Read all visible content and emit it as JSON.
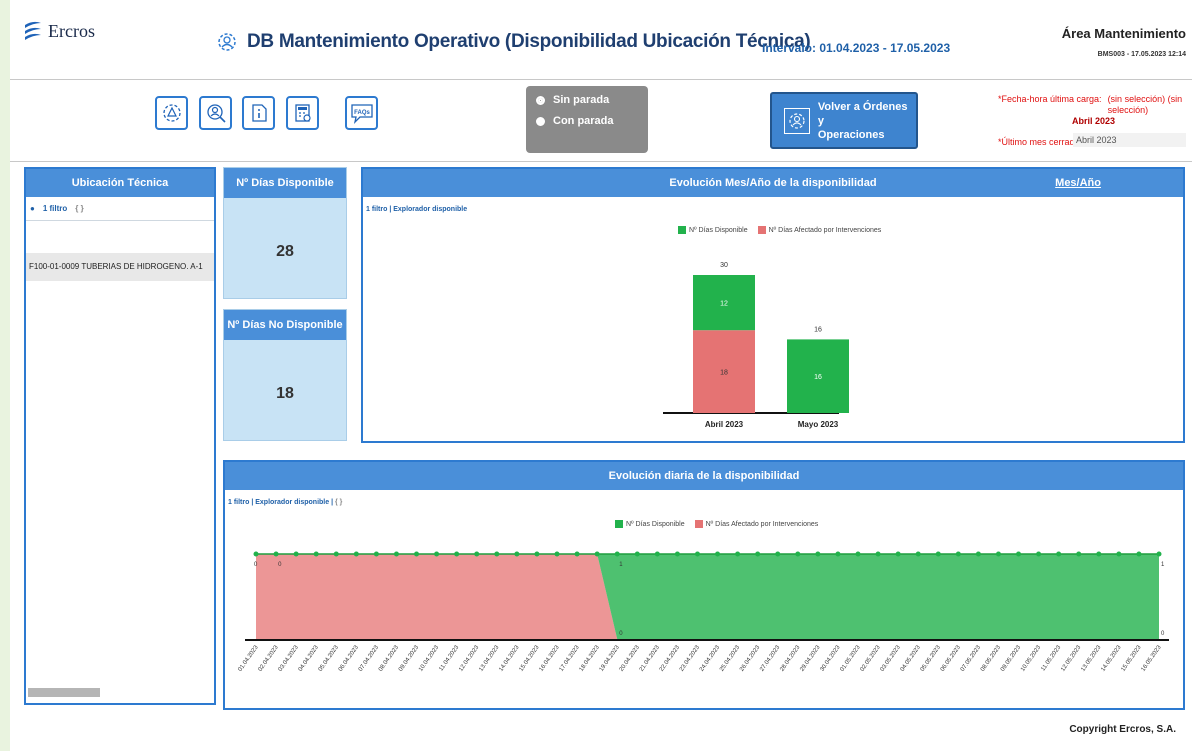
{
  "header": {
    "logo_text": "Ercros",
    "title": "DB Mantenimiento Operativo (Disponibilidad Ubicación Técnica)",
    "interval": "Intervalo: 01.04.2023 - 17.05.2023",
    "area": "Área Mantenimiento",
    "area_sub": "BMS003 - 17.05.2023 12:14"
  },
  "toolbar": {
    "buttons": [
      "gear-warning-icon",
      "user-search-icon",
      "document-info-icon",
      "calculator-gear-icon",
      "faq-icon"
    ],
    "faq_text": "FAQs",
    "radio": [
      {
        "label": "Sin parada",
        "selected": true
      },
      {
        "label": "Con parada",
        "selected": false
      }
    ],
    "volver_label_1": "Volver a Órdenes y",
    "volver_label_2": "Operaciones",
    "fecha_label": "*Fecha-hora última carga:",
    "fecha_value": "(sin selección) (sin selección)",
    "abril_label": "Abril 2023",
    "ultimo_label": "*Último mes cerrado:",
    "ultimo_value": "Abril 2023"
  },
  "ut": {
    "header": "Ubicación Técnica",
    "filter": "1 filtro",
    "row": "F100-01-0009 TUBERIAS DE HIDROGENO. A-1"
  },
  "kpi": {
    "disp_label": "Nº Días Disponible",
    "disp_value": "28",
    "nodisp_label": "Nº Días No Disponible",
    "nodisp_value": "18"
  },
  "monthly": {
    "header": "Evolución Mes/Año de la disponibilidad",
    "header_link": "Mes/Año",
    "filter_1": "1 filtro",
    "filter_2": "Explorador disponible"
  },
  "daily": {
    "header": "Evolución diaria de la disponibilidad",
    "filter_1": "1 filtro",
    "filter_2": "Explorador disponible"
  },
  "legend": {
    "disp": "Nº Días Disponible",
    "afect": "Nº Días Afectado por Intervenciones"
  },
  "colors": {
    "green": "#22b24c",
    "red": "#e57373",
    "blue": "#4a8fd9"
  },
  "copyright": "Copyright Ercros, S.A.",
  "chart_data": [
    {
      "type": "bar",
      "stacked": true,
      "categories": [
        "Abril 2023",
        "Mayo 2023"
      ],
      "series": [
        {
          "name": "Nº Días Disponible",
          "values": [
            12,
            16
          ],
          "color": "#22b24c"
        },
        {
          "name": "Nº Días Afectado por Intervenciones",
          "values": [
            18,
            0
          ],
          "color": "#e57373"
        }
      ],
      "totals": [
        30,
        16
      ],
      "title": "Evolución Mes/Año de la disponibilidad"
    },
    {
      "type": "area",
      "stacked": true,
      "title": "Evolución diaria de la disponibilidad",
      "x": [
        "01.04.2023",
        "02.04.2023",
        "03.04.2023",
        "04.04.2023",
        "05.04.2023",
        "06.04.2023",
        "07.04.2023",
        "08.04.2023",
        "09.04.2023",
        "10.04.2023",
        "11.04.2023",
        "12.04.2023",
        "13.04.2023",
        "14.04.2023",
        "15.04.2023",
        "16.04.2023",
        "17.04.2023",
        "18.04.2023",
        "19.04.2023",
        "20.04.2023",
        "21.04.2023",
        "22.04.2023",
        "23.04.2023",
        "24.04.2023",
        "25.04.2023",
        "26.04.2023",
        "27.04.2023",
        "28.04.2023",
        "29.04.2023",
        "30.04.2023",
        "01.05.2023",
        "02.05.2023",
        "03.05.2023",
        "04.05.2023",
        "05.05.2023",
        "06.05.2023",
        "07.05.2023",
        "08.05.2023",
        "09.05.2023",
        "10.05.2023",
        "11.05.2023",
        "12.05.2023",
        "13.05.2023",
        "14.05.2023",
        "15.05.2023",
        "16.05.2023"
      ],
      "series": [
        {
          "name": "Nº Días Disponible",
          "values": [
            0,
            0,
            0,
            0,
            0,
            0,
            0,
            0,
            0,
            0,
            0,
            0,
            0,
            0,
            0,
            0,
            0,
            0,
            1,
            1,
            1,
            1,
            1,
            1,
            1,
            1,
            1,
            1,
            1,
            1,
            1,
            1,
            1,
            1,
            1,
            1,
            1,
            1,
            1,
            1,
            1,
            1,
            1,
            1,
            1,
            1
          ],
          "color": "#22b24c"
        },
        {
          "name": "Nº Días Afectado por Intervenciones",
          "values": [
            1,
            1,
            1,
            1,
            1,
            1,
            1,
            1,
            1,
            1,
            1,
            1,
            1,
            1,
            1,
            1,
            1,
            1,
            0,
            0,
            0,
            0,
            0,
            0,
            0,
            0,
            0,
            0,
            0,
            0,
            0,
            0,
            0,
            0,
            0,
            0,
            0,
            0,
            0,
            0,
            0,
            0,
            0,
            0,
            0,
            0
          ],
          "color": "#e57373"
        }
      ],
      "point_labels": [
        {
          "index": 0,
          "text": "0"
        },
        {
          "index": 1,
          "text": "0"
        },
        {
          "index": 18,
          "text": "1"
        },
        {
          "index": 18,
          "text": "0"
        },
        {
          "index": 45,
          "text": "1"
        },
        {
          "index": 45,
          "text": "0"
        }
      ],
      "ylim": [
        0,
        1
      ]
    }
  ]
}
